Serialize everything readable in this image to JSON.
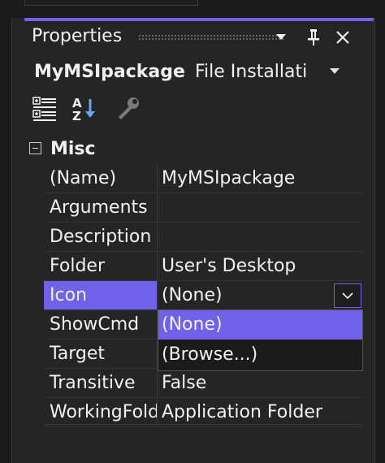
{
  "panel": {
    "title": "Properties",
    "buttons": {
      "options_icon": "dropdown-arrow",
      "pin_icon": "pin",
      "close_icon": "close"
    }
  },
  "object_selector": {
    "name": "MyMSIpackage",
    "type": "File Installatio"
  },
  "toolbar": {
    "categorized_icon": "categorized-view",
    "alphabetical_icon": "alphabetical-sort",
    "property_pages_icon": "wrench"
  },
  "grid": {
    "category": "Misc",
    "rows": [
      {
        "name": "(Name)",
        "value": "MyMSIpackage"
      },
      {
        "name": "Arguments",
        "value": ""
      },
      {
        "name": "Description",
        "value": ""
      },
      {
        "name": "Folder",
        "value": "User's Desktop"
      },
      {
        "name": "Icon",
        "value": "(None)"
      },
      {
        "name": "ShowCmd",
        "value": ""
      },
      {
        "name": "Target",
        "value": ""
      },
      {
        "name": "Transitive",
        "value": "False"
      },
      {
        "name": "WorkingFolder",
        "value": "Application Folder"
      }
    ]
  },
  "icon_dropdown": {
    "options": [
      "(None)",
      "(Browse...)"
    ],
    "selected": "(None)"
  },
  "colors": {
    "accent": "#7160e8",
    "background": "#252526",
    "text": "#f1f1f1"
  }
}
